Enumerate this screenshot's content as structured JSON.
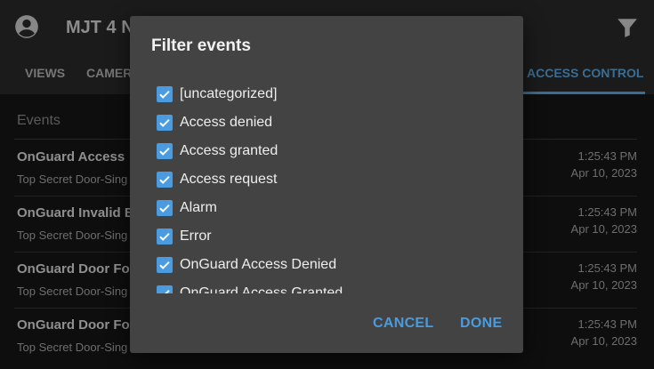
{
  "app": {
    "title": "MJT 4 N",
    "tabs": [
      {
        "label": "VIEWS"
      },
      {
        "label": "CAMERA"
      },
      {
        "label": "ACCESS CONTROL"
      }
    ]
  },
  "events": {
    "header": "Events",
    "items": [
      {
        "title": "OnGuard Access",
        "source": "Top Secret Door-Sing",
        "time": "1:25:43 PM",
        "date": "Apr 10, 2023"
      },
      {
        "title": "OnGuard Invalid B",
        "source": "Top Secret Door-Sing",
        "time": "1:25:43 PM",
        "date": "Apr 10, 2023"
      },
      {
        "title": "OnGuard Door For",
        "source": "Top Secret Door-Sing",
        "time": "1:25:43 PM",
        "date": "Apr 10, 2023"
      },
      {
        "title": "OnGuard Door For",
        "source": "Top Secret Door-Sing",
        "time": "1:25:43 PM",
        "date": "Apr 10, 2023"
      }
    ]
  },
  "dialog": {
    "title": "Filter events",
    "options": [
      {
        "label": "[uncategorized]",
        "checked": true
      },
      {
        "label": "Access denied",
        "checked": true
      },
      {
        "label": "Access granted",
        "checked": true
      },
      {
        "label": "Access request",
        "checked": true
      },
      {
        "label": "Alarm",
        "checked": true
      },
      {
        "label": "Error",
        "checked": true
      },
      {
        "label": "OnGuard Access Denied",
        "checked": true
      },
      {
        "label": "OnGuard Access Granted",
        "checked": true
      }
    ],
    "cancel_label": "CANCEL",
    "done_label": "DONE"
  },
  "colors": {
    "accent": "#4a9be0",
    "dialog_bg": "#434343",
    "toolbar_bg": "#2a2a2a"
  },
  "icons": {
    "account": "account-circle-icon",
    "filter": "filter-icon",
    "checkbox": "check-icon"
  }
}
